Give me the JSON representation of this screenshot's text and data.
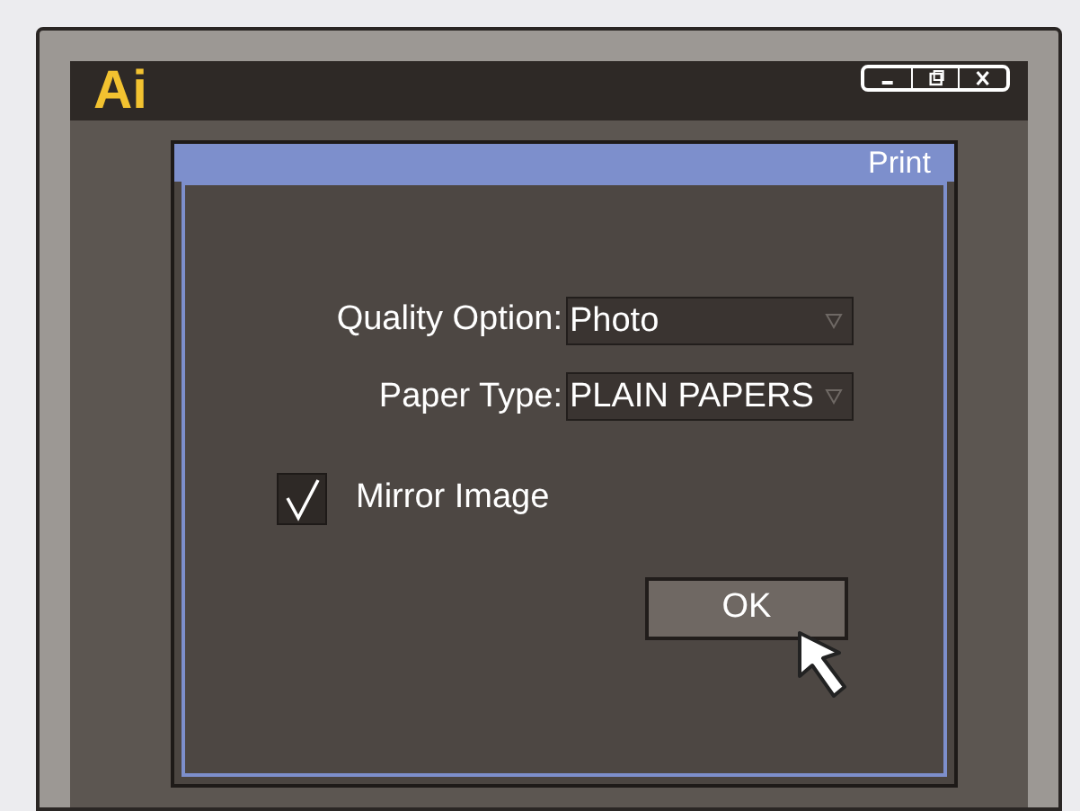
{
  "app": {
    "logo": "Ai"
  },
  "dialog": {
    "title": "Print",
    "fields": [
      {
        "label": "Quality Option:",
        "value": "Photo"
      },
      {
        "label": "Paper Type:",
        "value": "PLAIN PAPERS"
      }
    ],
    "checkbox": {
      "label": "Mirror Image",
      "checked": true
    },
    "buttons": [
      "OK"
    ]
  }
}
